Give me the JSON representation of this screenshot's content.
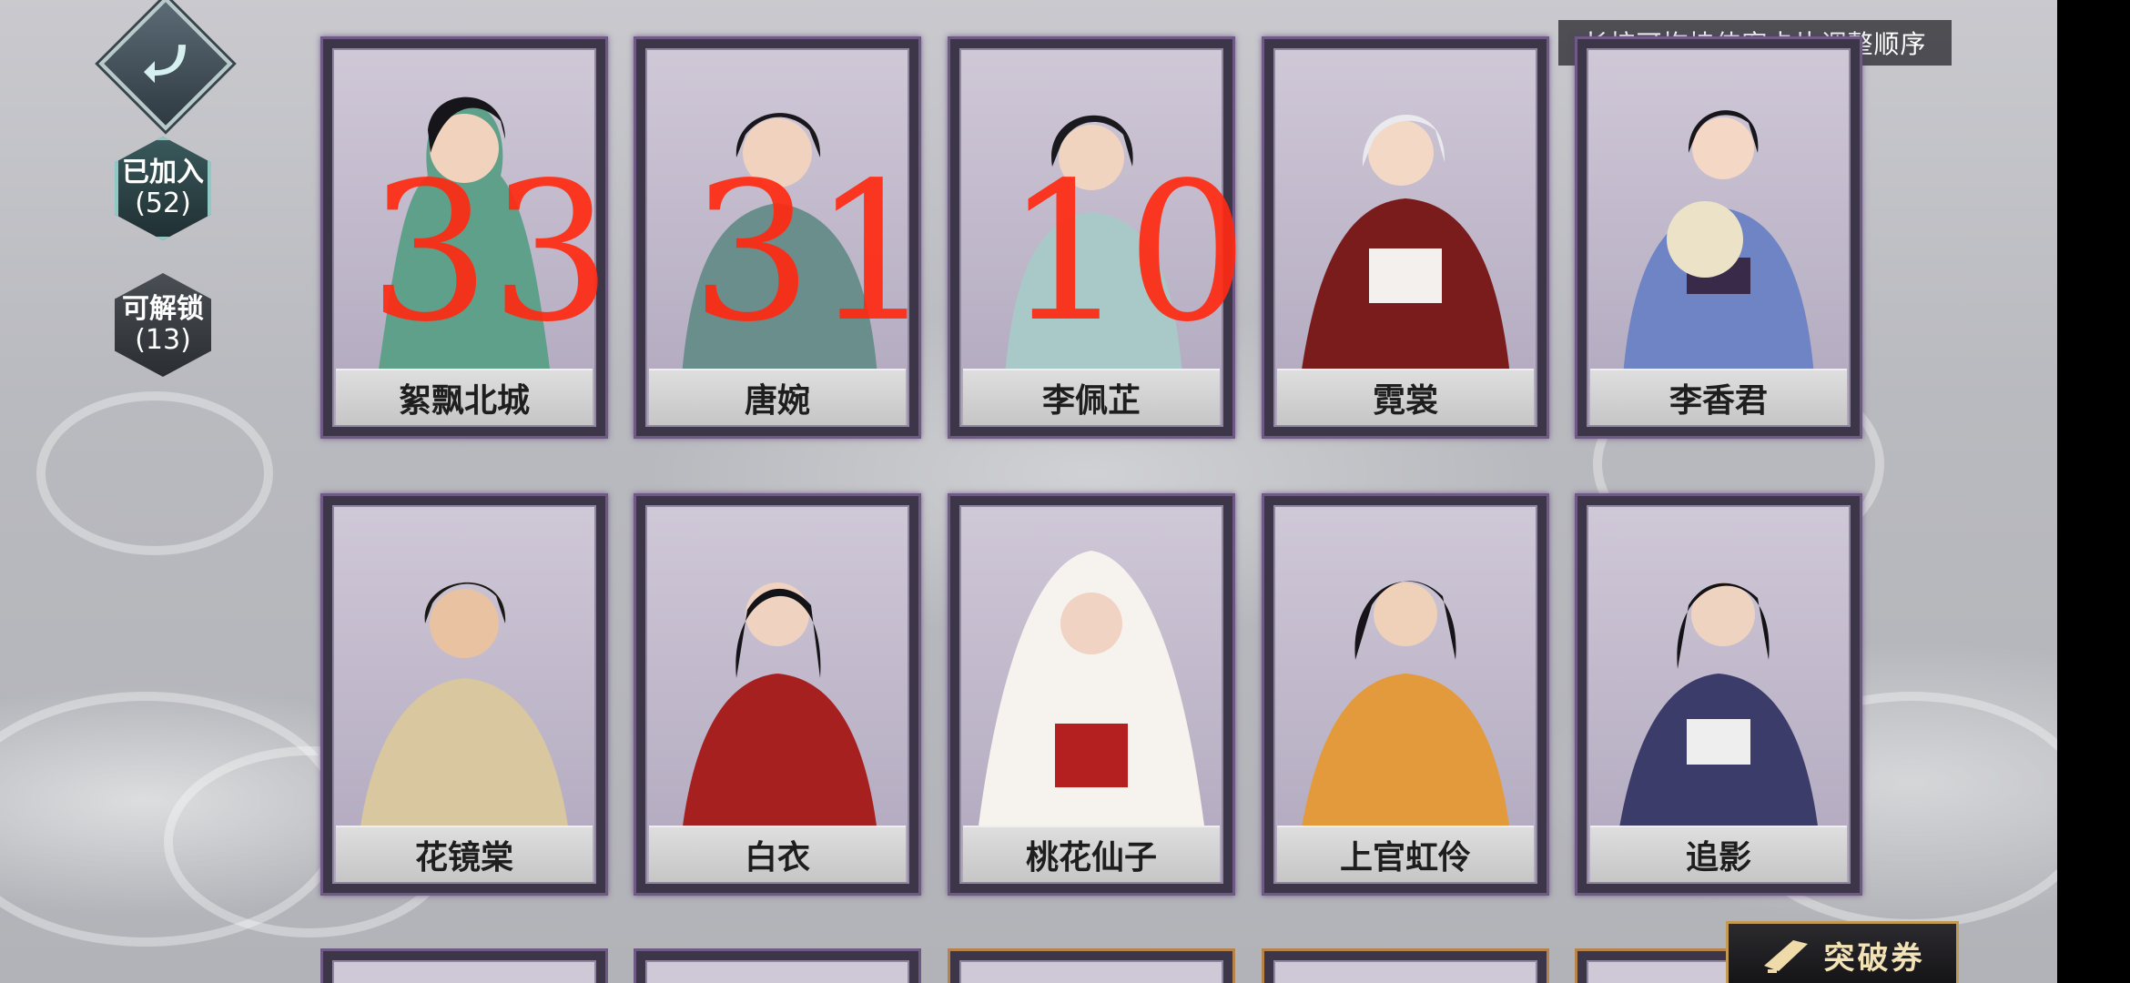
{
  "header": {
    "hint": "长按可拖拽侠客卡片调整顺序"
  },
  "sidebar": {
    "joined": {
      "label": "已加入",
      "count": "(52)"
    },
    "unlockable": {
      "label": "可解锁",
      "count": "(13)"
    }
  },
  "cards": [
    {
      "name": "絮飘北城",
      "annotation": "33"
    },
    {
      "name": "唐婉",
      "annotation": "31"
    },
    {
      "name": "李佩芷",
      "annotation": "10"
    },
    {
      "name": "霓裳"
    },
    {
      "name": "李香君"
    },
    {
      "name": "花镜棠"
    },
    {
      "name": "白衣"
    },
    {
      "name": "桃花仙子"
    },
    {
      "name": "上官虹伶"
    },
    {
      "name": "追影"
    }
  ],
  "ticket": {
    "label": "突破券"
  },
  "colors": {
    "card_border": "#6f5a86",
    "annotation": "#ff2a12",
    "ticket_border": "#c29a52"
  }
}
